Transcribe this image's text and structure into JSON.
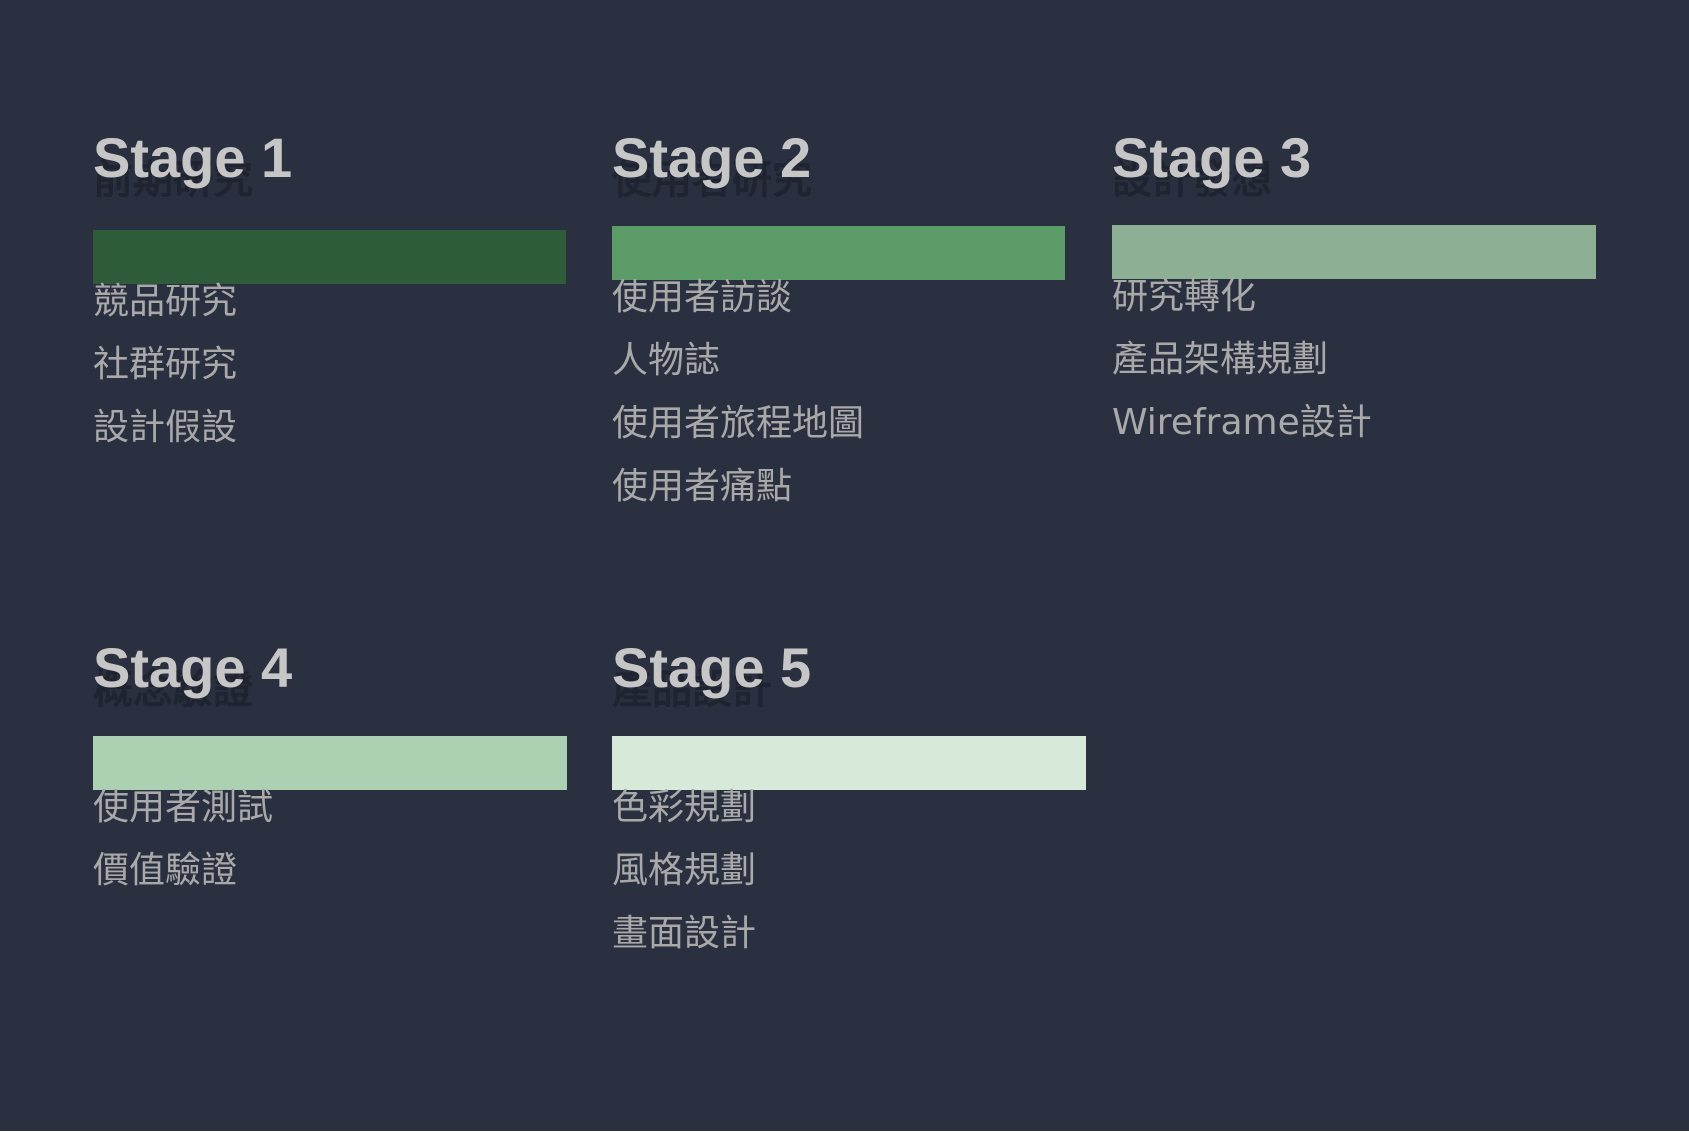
{
  "colors": {
    "background": "#2b3041",
    "title": "#c6c6c6",
    "subtitle": "#1f2430",
    "item_text": "#a9a9a9"
  },
  "stages": [
    {
      "title": "Stage 1",
      "subtitle": "前期研究",
      "bar_color": "#2e5b3a",
      "items": [
        "競品研究",
        "社群研究",
        "設計假設"
      ]
    },
    {
      "title": "Stage 2",
      "subtitle": "使用者研究",
      "bar_color": "#5a9b68",
      "items": [
        "使用者訪談",
        "人物誌",
        "使用者旅程地圖",
        "使用者痛點"
      ]
    },
    {
      "title": "Stage 3",
      "subtitle": "設計發想",
      "bar_color": "#8db094",
      "items": [
        "研究轉化",
        "產品架構規劃",
        "Wireframe設計"
      ]
    },
    {
      "title": "Stage 4",
      "subtitle": "概念驗證",
      "bar_color": "#acd1b2",
      "items": [
        "使用者測試",
        "價值驗證"
      ]
    },
    {
      "title": "Stage 5",
      "subtitle": "產品設計",
      "bar_color": "#d7ead9",
      "items": [
        "色彩規劃",
        "風格規劃",
        "畫面設計"
      ]
    }
  ]
}
